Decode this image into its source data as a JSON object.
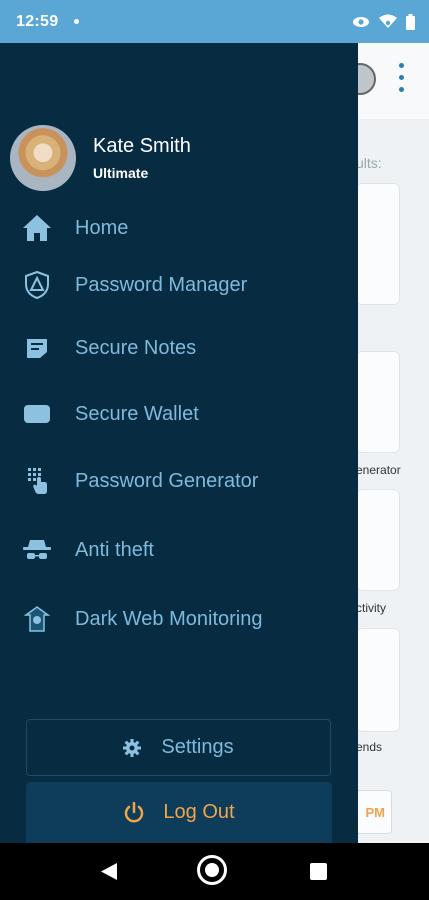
{
  "status_bar": {
    "time": "12:59"
  },
  "background": {
    "partial_text_1": "ults:",
    "partial_text_2": "enerator",
    "partial_text_3": "ctivity",
    "partial_text_4": "ends",
    "pm_button": "PM"
  },
  "profile": {
    "name": "Kate Smith",
    "tier": "Ultimate"
  },
  "menu": {
    "items": [
      {
        "label": "Home",
        "icon": "home-icon"
      },
      {
        "label": "Password Manager",
        "icon": "shield-icon"
      },
      {
        "label": "Secure Notes",
        "icon": "note-icon"
      },
      {
        "label": "Secure Wallet",
        "icon": "wallet-icon"
      },
      {
        "label": "Password Generator",
        "icon": "keypad-icon"
      },
      {
        "label": "Anti theft",
        "icon": "spy-icon"
      },
      {
        "label": "Dark Web Monitoring",
        "icon": "web-monitor-icon"
      }
    ]
  },
  "settings_label": "Settings",
  "logout_label": "Log Out",
  "colors": {
    "drawer_bg": "#072c42",
    "accent": "#7fb9dc",
    "logout": "#f2a446",
    "status_bar": "#5aa7d6"
  }
}
